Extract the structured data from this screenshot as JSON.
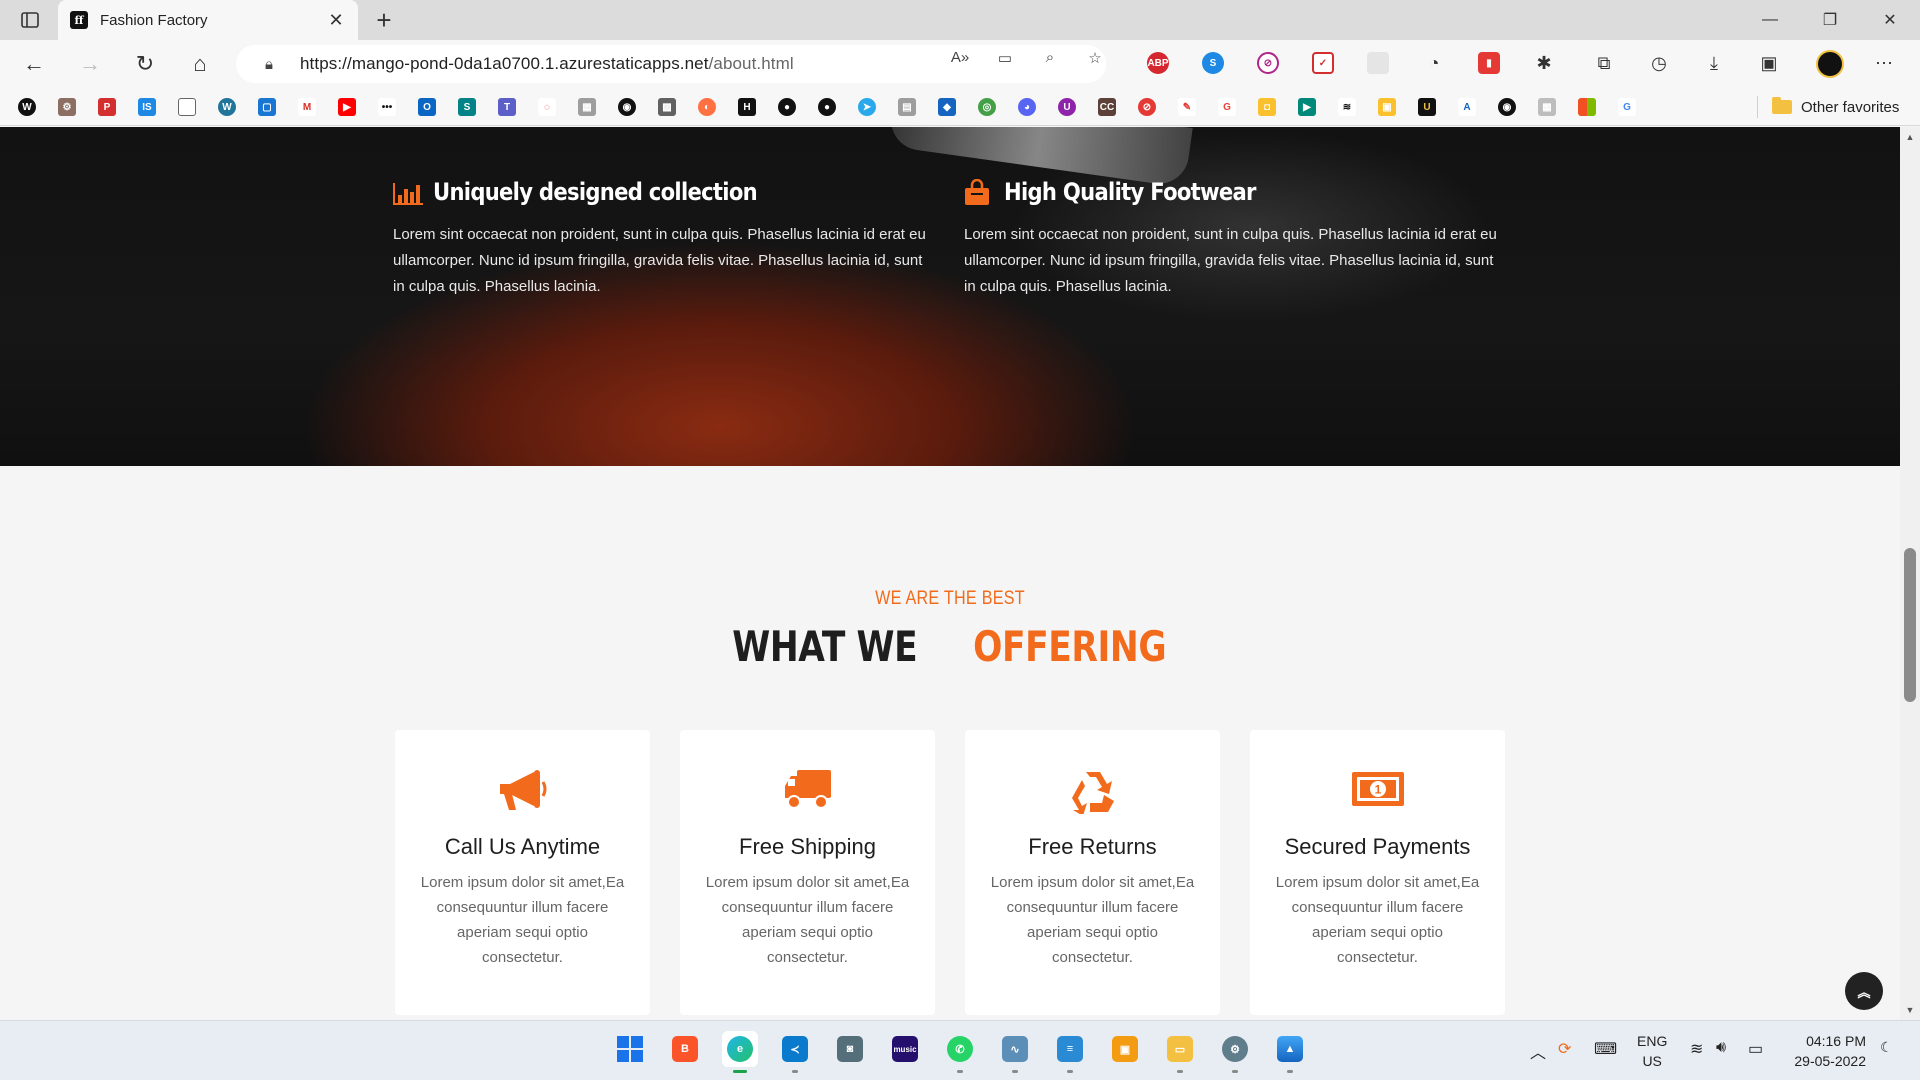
{
  "browser": {
    "tab_title": "Fashion Factory",
    "favicon_text": "ff",
    "url_host": "https://mango-pond-0da1a0700.1.azurestaticapps.net",
    "url_path": "/about.html",
    "other_favorites": "Other favorites"
  },
  "hero": {
    "features": [
      {
        "title": "Uniquely designed collection",
        "icon": "bar-chart-icon",
        "text": "Lorem sint occaecat non proident, sunt in culpa quis. Phasellus lacinia id erat eu ullamcorper. Nunc id ipsum fringilla, gravida felis vitae. Phasellus lacinia id, sunt in culpa quis. Phasellus lacinia."
      },
      {
        "title": "High Quality Footwear",
        "icon": "shopping-bag-icon",
        "text": "Lorem sint occaecat non proident, sunt in culpa quis. Phasellus lacinia id erat eu ullamcorper. Nunc id ipsum fringilla, gravida felis vitae. Phasellus lacinia id, sunt in culpa quis. Phasellus lacinia."
      }
    ]
  },
  "offering": {
    "subtitle": "WE ARE THE BEST",
    "title_plain": "WHAT WE",
    "title_accent": "OFFERING",
    "cards": [
      {
        "title": "Call Us Anytime",
        "icon": "megaphone-icon",
        "text": "Lorem ipsum dolor sit amet,Ea consequuntur illum facere aperiam sequi optio consectetur."
      },
      {
        "title": "Free Shipping",
        "icon": "truck-icon",
        "text": "Lorem ipsum dolor sit amet,Ea consequuntur illum facere aperiam sequi optio consectetur."
      },
      {
        "title": "Free Returns",
        "icon": "recycle-icon",
        "text": "Lorem ipsum dolor sit amet,Ea consequuntur illum facere aperiam sequi optio consectetur."
      },
      {
        "title": "Secured Payments",
        "icon": "money-bill-icon",
        "text": "Lorem ipsum dolor sit amet,Ea consequuntur illum facere aperiam sequi optio consectetur."
      }
    ]
  },
  "taskbar": {
    "language": "ENG",
    "region": "US",
    "time": "04:16 PM",
    "date": "29-05-2022"
  },
  "colors": {
    "accent": "#f26b1d",
    "hero_bg": "#141414",
    "card_bg": "#ffffff"
  }
}
